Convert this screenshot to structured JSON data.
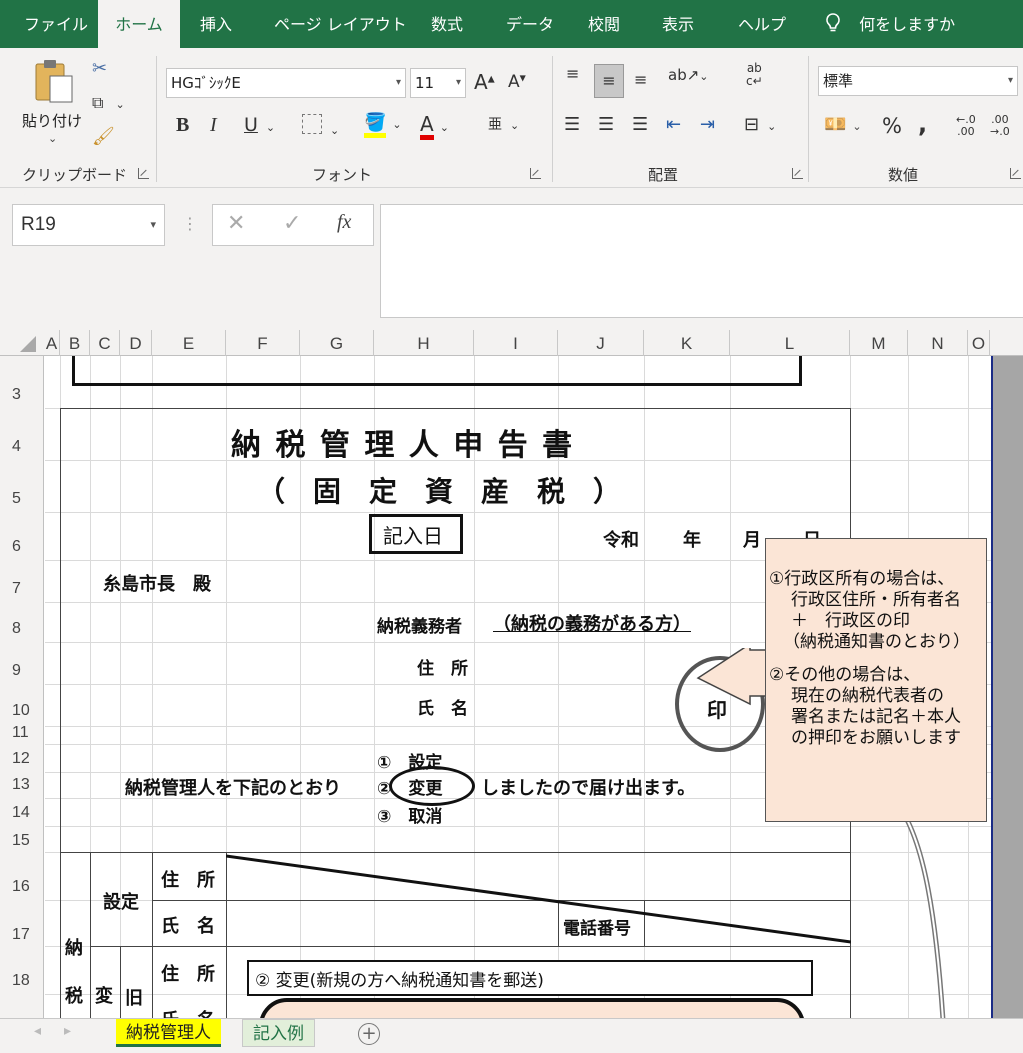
{
  "ribbon_tabs": [
    "ファイル",
    "ホーム",
    "挿入",
    "ページ レイアウト",
    "数式",
    "データ",
    "校閲",
    "表示",
    "ヘルプ"
  ],
  "tell_me": "何をしますか",
  "clipboard": {
    "paste_label": "貼り付け",
    "group_label": "クリップボード"
  },
  "font": {
    "name": "HGｺﾞｼｯｸE",
    "size": "11",
    "group_label": "フォント"
  },
  "alignment": {
    "group_label": "配置"
  },
  "number": {
    "format": "標準",
    "group_label": "数値"
  },
  "formula_bar": {
    "name_box": "R19",
    "fx": "fx",
    "content": ""
  },
  "columns": [
    "A",
    "B",
    "C",
    "D",
    "E",
    "F",
    "G",
    "H",
    "I",
    "J",
    "K",
    "L",
    "M",
    "N",
    "O"
  ],
  "rows": [
    "3",
    "4",
    "5",
    "6",
    "7",
    "8",
    "9",
    "10",
    "11",
    "12",
    "13",
    "14",
    "15",
    "16",
    "17",
    "18"
  ],
  "sheet": {
    "title": "納 税 管 理 人 申 告 書",
    "subtitle": "（　固　定　資　産　税　）",
    "kinyubi": "記入日",
    "reiwa": "令和",
    "nen": "年",
    "tsuki": "月",
    "hi": "日",
    "addressee": "糸島市長　殿",
    "taxpayer_label": "納税義務者",
    "taxpayer_note": "（納税の義務がある方）",
    "address_label": "住　所",
    "name_label": "氏　名",
    "seal": "印",
    "opt1": "①　設定",
    "opt2": "②　変更",
    "opt3": "③　取消",
    "statement_pre": "納税管理人を下記のとおり",
    "statement_post": "しましたので届け出ます。",
    "settei": "設定",
    "jusho": "住　所",
    "shimei": "氏　名",
    "phone": "電話番号",
    "nouzei_1": "納",
    "nouzei_2": "税",
    "henko": "変",
    "kyu": "旧",
    "henko_note": "②  変更(新規の方へ納税通知書を郵送)"
  },
  "callout": {
    "line1": "①行政区所有の場合は、",
    "line2": "行政区住所・所有者名",
    "line3": "＋　行政区の印",
    "line4": "（納税通知書のとおり）",
    "line5": "②その他の場合は、",
    "line6": "現在の納税代表者の",
    "line7": "署名または記名＋本人",
    "line8": "の押印をお願いします"
  },
  "sheet_tabs": [
    "納税管理人",
    "記入例"
  ]
}
